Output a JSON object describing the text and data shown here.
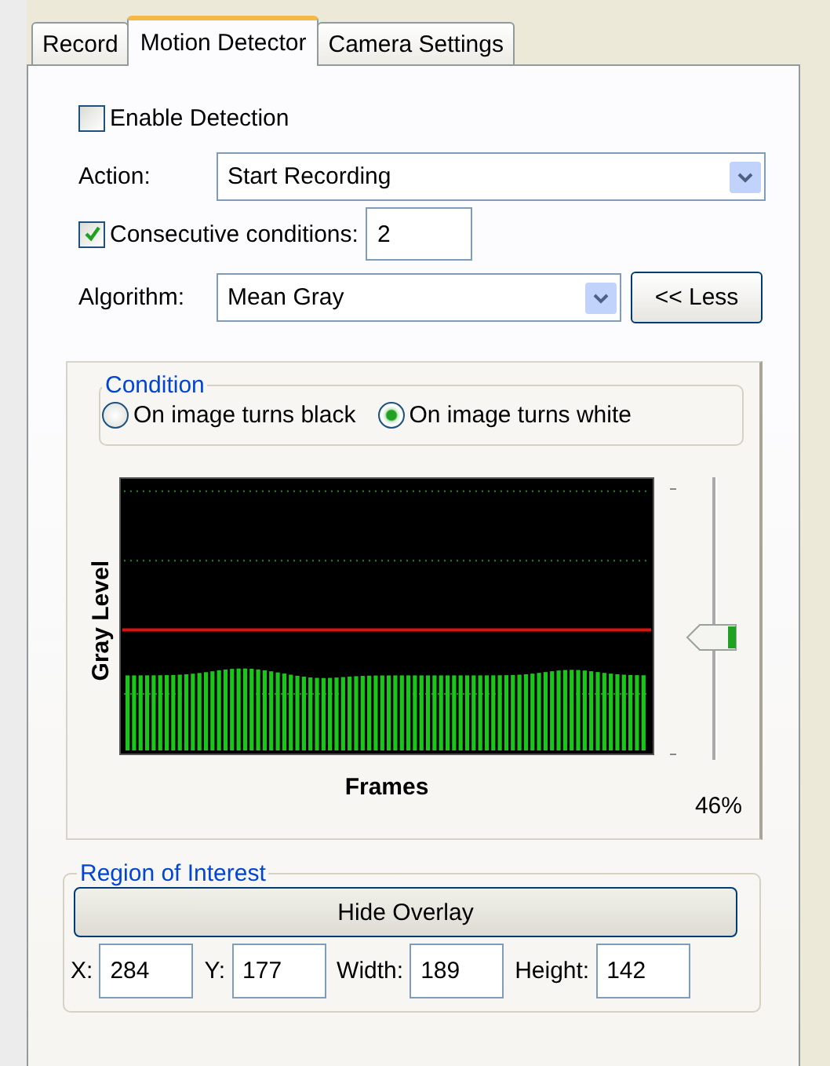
{
  "tabs": [
    {
      "label": "Record",
      "selected": false
    },
    {
      "label": "Motion Detector",
      "selected": true
    },
    {
      "label": "Camera Settings",
      "selected": false
    }
  ],
  "enable_detection": {
    "label": "Enable Detection",
    "checked": false
  },
  "action": {
    "label": "Action:",
    "value": "Start Recording"
  },
  "consecutive_conditions": {
    "label": "Consecutive conditions:",
    "checked": true,
    "value": "2"
  },
  "algorithm": {
    "label": "Algorithm:",
    "value": "Mean Gray"
  },
  "less_button": "<< Less",
  "condition": {
    "title": "Condition",
    "options": [
      {
        "label": "On image turns black",
        "selected": false
      },
      {
        "label": "On image turns white",
        "selected": true
      }
    ]
  },
  "graph": {
    "ylabel": "Gray Level",
    "xlabel": "Frames"
  },
  "threshold": {
    "level": 0.46,
    "reading": "46%"
  },
  "region_of_interest": {
    "title": "Region of Interest",
    "button": "Hide Overlay",
    "fields": [
      {
        "label": "X:",
        "value": "284"
      },
      {
        "label": "Y:",
        "value": "177"
      },
      {
        "label": "Width:",
        "value": "189"
      },
      {
        "label": "Height:",
        "value": "142"
      }
    ]
  }
}
